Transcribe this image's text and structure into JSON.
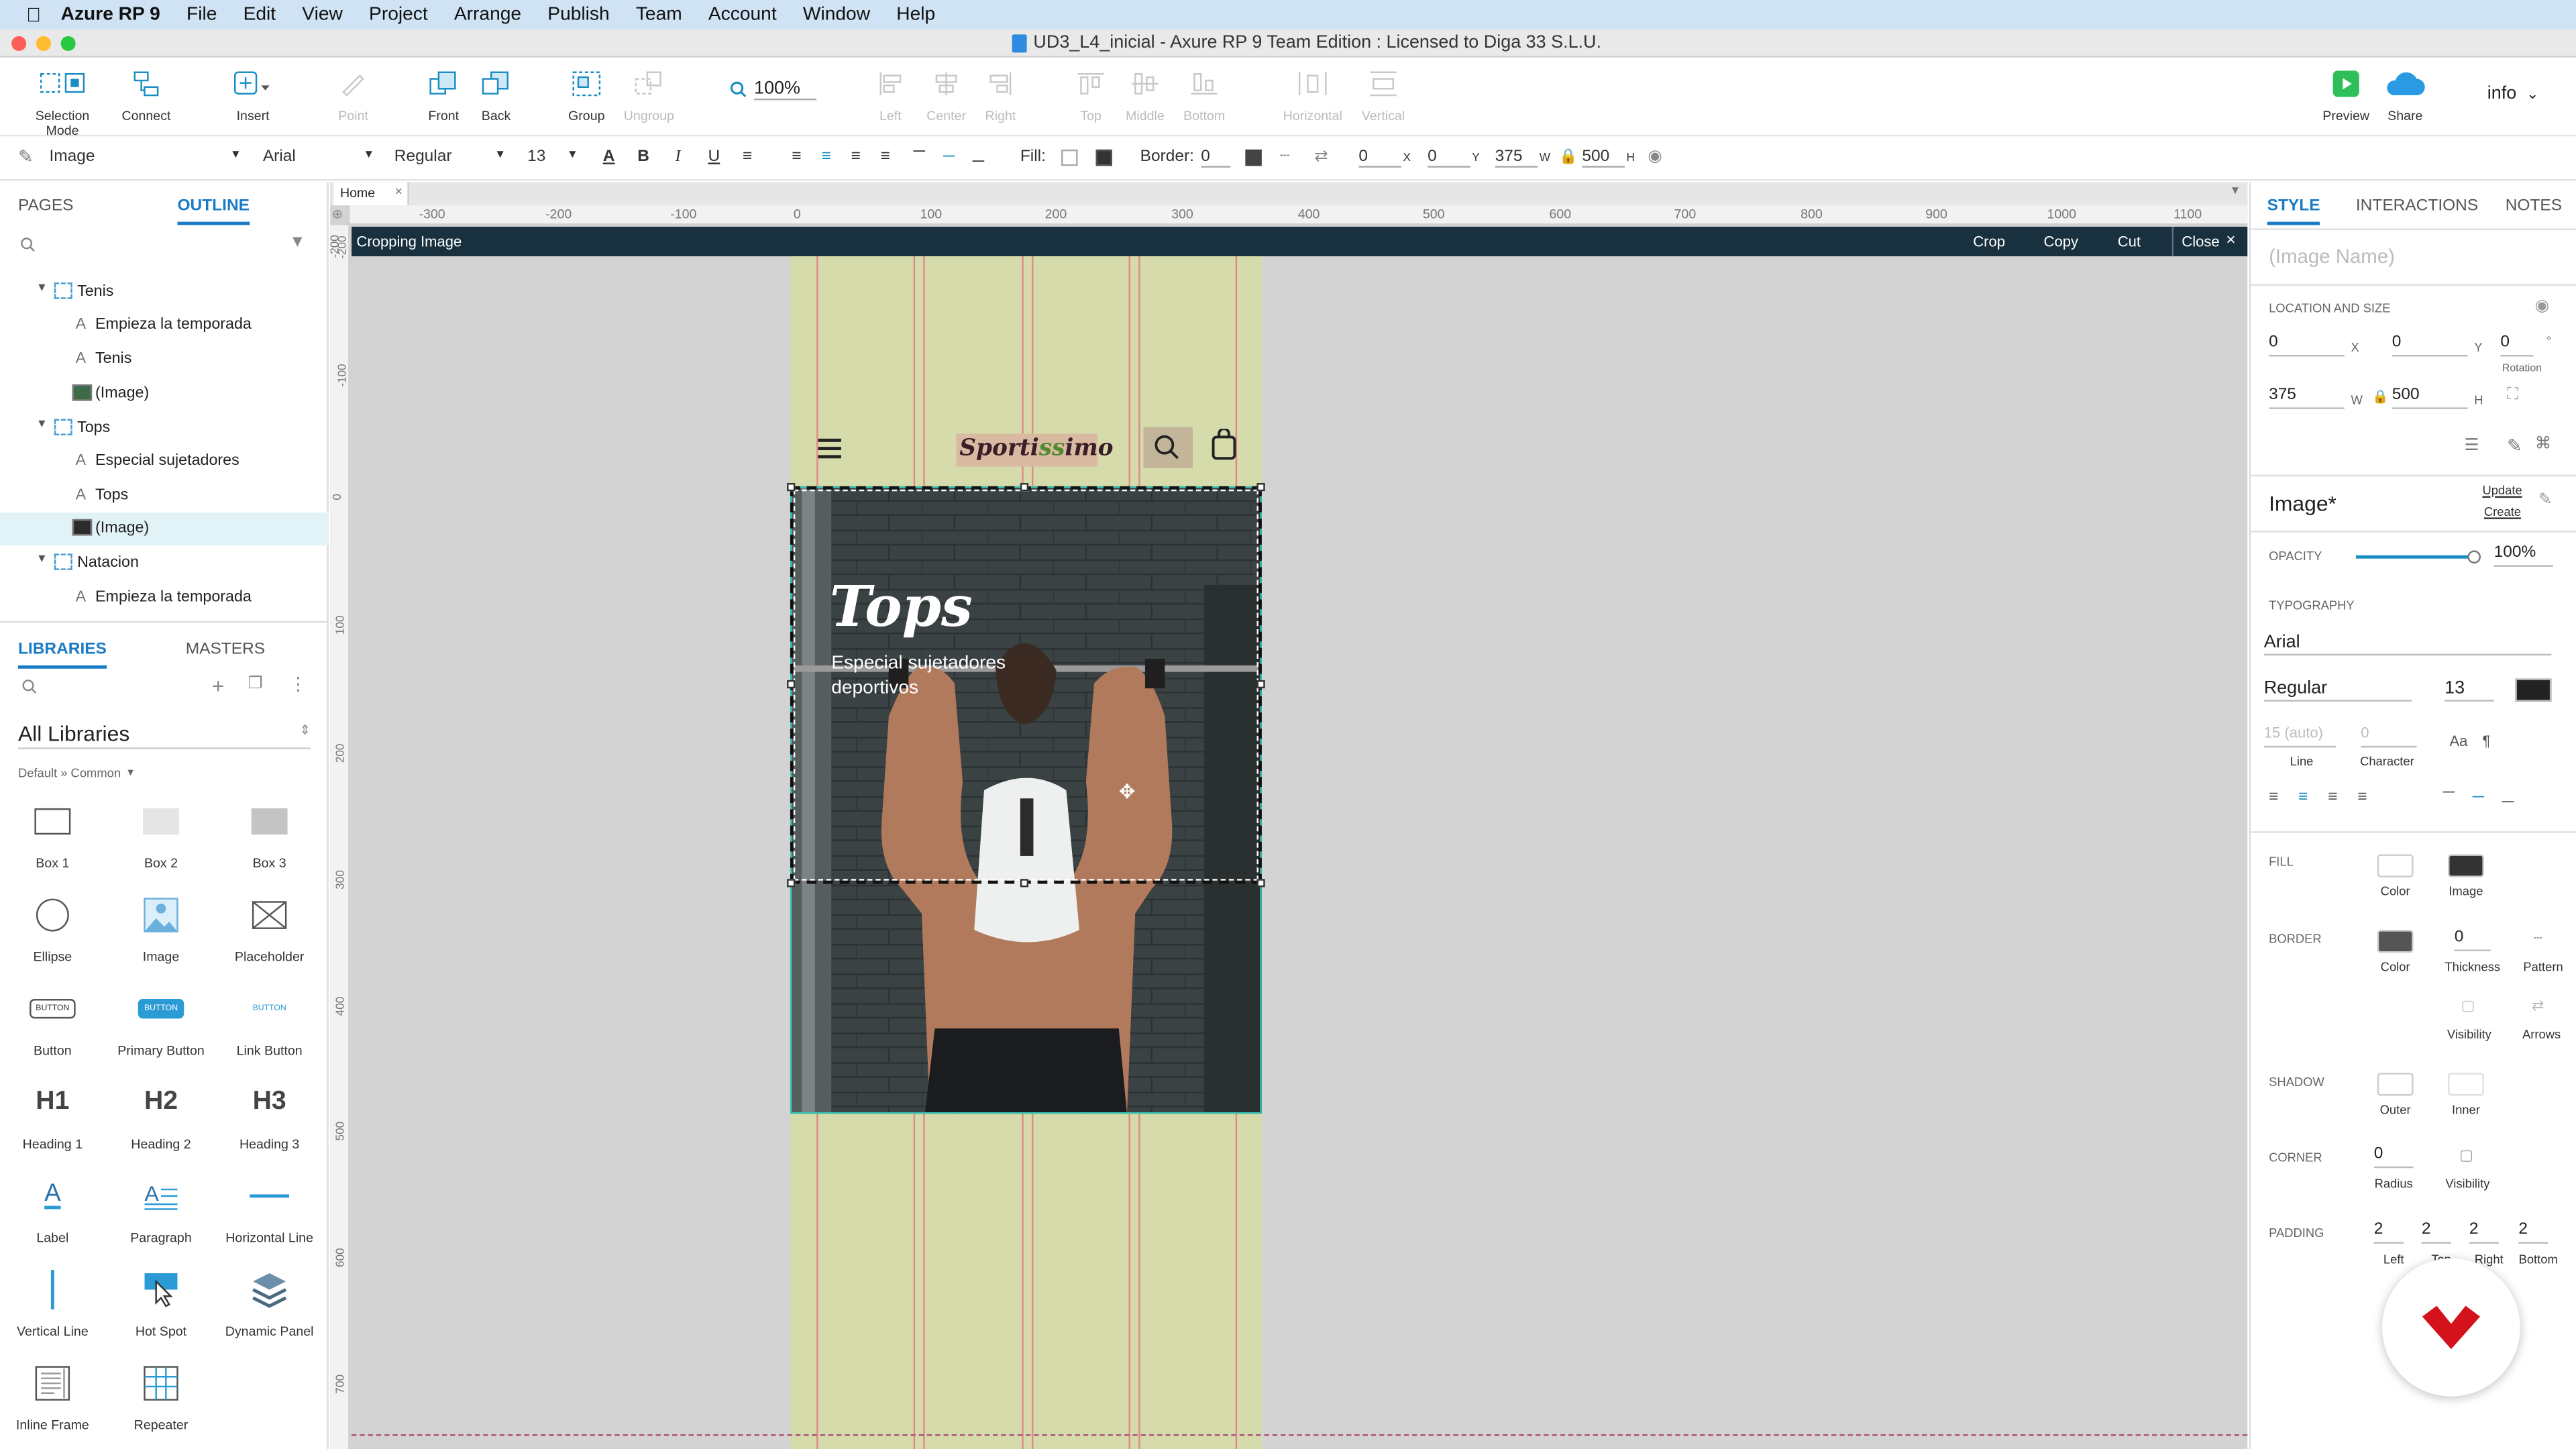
{
  "menubar": {
    "app": "Azure RP 9",
    "items": [
      "File",
      "Edit",
      "View",
      "Project",
      "Arrange",
      "Publish",
      "Team",
      "Account",
      "Window",
      "Help"
    ]
  },
  "window": {
    "title": "UD3_L4_inicial - Axure RP 9 Team Edition : Licensed to Diga 33 S.L.U."
  },
  "toolbar": {
    "selection_mode": "Selection Mode",
    "connect": "Connect",
    "insert": "Insert",
    "point": "Point",
    "front": "Front",
    "back": "Back",
    "group": "Group",
    "ungroup": "Ungroup",
    "zoom": "100%",
    "left": "Left",
    "center": "Center",
    "right": "Right",
    "top": "Top",
    "middle": "Middle",
    "bottom": "Bottom",
    "horizontal": "Horizontal",
    "vertical": "Vertical",
    "preview": "Preview",
    "share": "Share",
    "account": "info"
  },
  "formatbar": {
    "style": "Image",
    "font": "Arial",
    "weight": "Regular",
    "size": "13",
    "fill_label": "Fill:",
    "border_label": "Border:",
    "border_value": "0",
    "x": "0",
    "x_lbl": "X",
    "y": "0",
    "y_lbl": "Y",
    "w": "375",
    "w_lbl": "W",
    "h": "500",
    "h_lbl": "H"
  },
  "left_panel": {
    "tabs": [
      "PAGES",
      "OUTLINE"
    ],
    "outline": [
      {
        "label": "Tenis",
        "type": "folder",
        "expanded": true
      },
      {
        "label": "Empieza la temporada",
        "type": "text"
      },
      {
        "label": "Tenis",
        "type": "text"
      },
      {
        "label": "(Image)",
        "type": "image"
      },
      {
        "label": "Tops",
        "type": "folder",
        "expanded": true
      },
      {
        "label": "Especial sujetadores",
        "type": "text"
      },
      {
        "label": "Tops",
        "type": "text"
      },
      {
        "label": "(Image)",
        "type": "image",
        "selected": true
      },
      {
        "label": "Natacion",
        "type": "folder",
        "expanded": true
      },
      {
        "label": "Empieza la temporada",
        "type": "text"
      }
    ],
    "lib_tabs": [
      "LIBRARIES",
      "MASTERS"
    ],
    "library_select": "All Libraries",
    "library_sub": "Default » Common",
    "widgets": [
      "Box 1",
      "Box 2",
      "Box 3",
      "Ellipse",
      "Image",
      "Placeholder",
      "Button",
      "Primary Button",
      "Link Button",
      "Heading 1",
      "Heading 2",
      "Heading 3",
      "Label",
      "Paragraph",
      "Horizontal Line",
      "Vertical Line",
      "Hot Spot",
      "Dynamic Panel",
      "Inline Frame",
      "Repeater"
    ],
    "widget_glyphs": {
      "h1": "H1",
      "h2": "H2",
      "h3": "H3",
      "btn": "BUTTON"
    }
  },
  "canvas": {
    "doc_tab": "Home",
    "ruler_h": [
      "-300",
      "-200",
      "-100",
      "0",
      "100",
      "200",
      "300",
      "400",
      "500",
      "600",
      "700",
      "800",
      "900",
      "1000",
      "1100"
    ],
    "ruler_v": [
      "-200",
      "-100",
      "0",
      "100",
      "200",
      "300",
      "400",
      "500",
      "600",
      "700"
    ],
    "crop_title": "Cropping Image",
    "crop_actions": [
      "Crop",
      "Copy",
      "Cut",
      "Close"
    ],
    "site": {
      "brand_a": "Sporti",
      "brand_b": "ss",
      "brand_c": "imo",
      "hero_title": "Tops",
      "hero_subtitle_1": "Especial sujetadores",
      "hero_subtitle_2": "deportivos"
    },
    "colors": {
      "page_bg": "#d6dbab",
      "canvas_bg": "#d3d3d3",
      "crop_bar": "#19313f",
      "guide": "#e26d7c"
    }
  },
  "right_panel": {
    "tabs": [
      "STYLE",
      "INTERACTIONS",
      "NOTES"
    ],
    "name_placeholder": "(Image Name)",
    "location_label": "LOCATION AND SIZE",
    "x": "0",
    "y": "0",
    "rotation": "0",
    "rotation_unit": "°",
    "w": "375",
    "h": "500",
    "x_lbl": "X",
    "y_lbl": "Y",
    "w_lbl": "W",
    "h_lbl": "H",
    "rotation_lbl": "Rotation",
    "style_name": "Image*",
    "update": "Update",
    "create": "Create",
    "opacity_label": "OPACITY",
    "opacity": "100%",
    "opacity_fraction": 1.0,
    "typography_label": "TYPOGRAPHY",
    "font": "Arial",
    "weight": "Regular",
    "size": "13",
    "line": "15 (auto)",
    "line_lbl": "Line",
    "character": "0",
    "character_lbl": "Character",
    "fill_label": "FILL",
    "fill_color": "Color",
    "fill_image": "Image",
    "border_label": "BORDER",
    "border_color": "Color",
    "border_thickness": "0",
    "border_thickness_lbl": "Thickness",
    "border_pattern": "Pattern",
    "visibility": "Visibility",
    "arrows": "Arrows",
    "shadow_label": "SHADOW",
    "outer": "Outer",
    "inner": "Inner",
    "corner_label": "CORNER",
    "radius": "0",
    "radius_lbl": "Radius",
    "corner_visibility": "Visibility",
    "padding_label": "PADDING",
    "padding": [
      "2",
      "2",
      "2",
      "2"
    ],
    "padding_lbls": [
      "Left",
      "Top",
      "Right",
      "Bottom"
    ]
  }
}
